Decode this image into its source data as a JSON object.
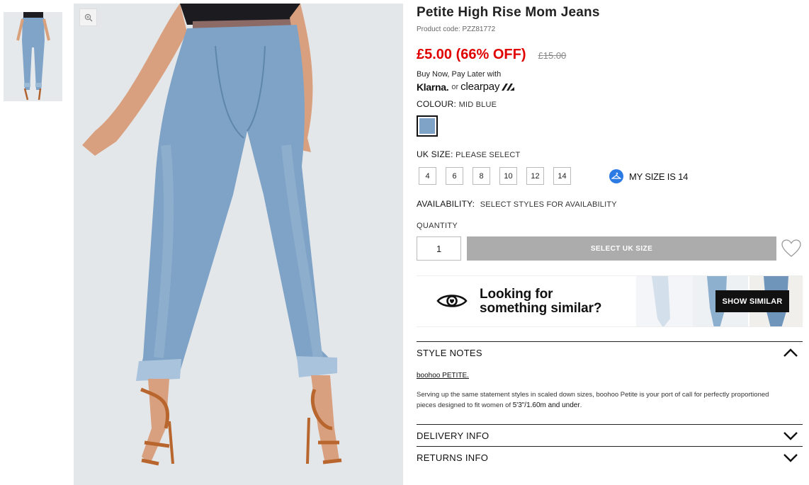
{
  "product": {
    "title": "Petite High Rise Mom Jeans",
    "code": "Product code: PZZ81772",
    "price_now": "£5.00 (66% OFF)",
    "price_was": "£15.00"
  },
  "bnpl": {
    "text": "Buy Now, Pay Later with",
    "klarna": "Klarna.",
    "or": "or",
    "clearpay": "clearpay"
  },
  "colour": {
    "label": "COLOUR:",
    "value": "MID BLUE",
    "swatch_color": "#7ea3c6"
  },
  "size": {
    "label": "UK SIZE:",
    "value": "PLEASE SELECT",
    "options": [
      "4",
      "6",
      "8",
      "10",
      "12",
      "14"
    ],
    "my_size_label": "MY SIZE IS 14"
  },
  "availability": {
    "label": "AVAILABILITY:",
    "value": "SELECT STYLES FOR AVAILABILITY"
  },
  "quantity": {
    "label": "QUANTITY",
    "value": "1"
  },
  "add_button": "SELECT UK SIZE",
  "similar": {
    "line1": "Looking for",
    "line2": "something similar?",
    "button": "SHOW SIMILAR"
  },
  "style_notes": {
    "title": "STYLE NOTES",
    "brand": "boohoo PETITE.",
    "desc_a": "Serving up the same statement styles in scaled down sizes, boohoo Petite is your port of call for perfectly proportioned pieces designed to fit women of ",
    "desc_b": "5'3\"/1.60m and under",
    "desc_c": "."
  },
  "delivery": {
    "title": "DELIVERY INFO"
  },
  "returns": {
    "title": "RETURNS INFO"
  },
  "colors": {
    "price_red": "#e00000",
    "button_grey": "#acacac",
    "mysize_blue": "#2c7be5",
    "denim": "#7ea3c6"
  },
  "icons": [
    "zoom-icon",
    "hanger-icon",
    "heart-icon",
    "eye-icon",
    "chevron-up-icon",
    "chevron-down-icon"
  ]
}
